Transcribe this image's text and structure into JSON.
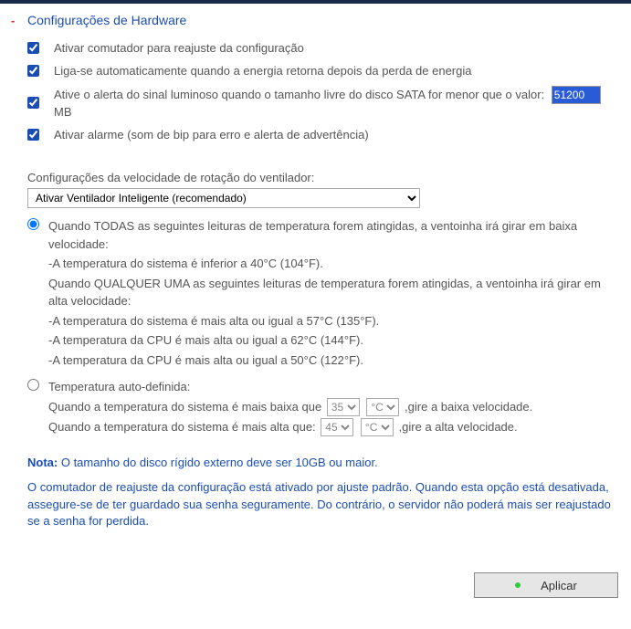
{
  "section": {
    "collapse_glyph": "-",
    "title": "Configurações de Hardware"
  },
  "checks": {
    "reset_switch": {
      "checked": true,
      "label": "Ativar comutador para reajuste da configuração"
    },
    "auto_power": {
      "checked": true,
      "label": "Liga-se automaticamente quando a energia retorna depois da perda de energia"
    },
    "sata_alert": {
      "checked": true,
      "label_before": "Ative o alerta do sinal luminoso quando o tamanho livre do disco SATA for menor que o valor:",
      "value": "51200",
      "label_after": "MB"
    },
    "buzzer": {
      "checked": true,
      "label": "Ativar alarme (som de bip para erro e alerta de advertência)"
    }
  },
  "fan": {
    "label": "Configurações da velocidade de rotação do ventilador:",
    "mode_selected": "Ativar Ventilador Inteligente (recomendado)",
    "smart": {
      "selected": true,
      "intro": "Quando TODAS as seguintes leituras de temperatura forem atingidas, a ventoinha irá girar em baixa velocidade:",
      "low1": "-A temperatura do sistema é inferior a 40°C (104°F).",
      "high_intro": "Quando QUALQUER UMA as seguintes leituras de temperatura forem atingidas, a ventoinha irá girar em alta velocidade:",
      "high1": "-A temperatura do sistema é mais alta ou igual a 57°C (135°F).",
      "high2": "-A temperatura da CPU é mais alta ou igual a 62°C (144°F).",
      "high3": "-A temperatura da CPU é mais alta ou igual a 50°C (122°F)."
    },
    "custom": {
      "selected": false,
      "title": "Temperatura auto-definida:",
      "low_before": "Quando a temperatura do sistema é mais baixa que",
      "low_temp": "35",
      "unit": "°C",
      "low_after": ",gire a baixa velocidade.",
      "high_before": "Quando a temperatura do sistema é mais alta que:",
      "high_temp": "45",
      "high_after": ",gire a alta velocidade."
    }
  },
  "note": {
    "label": "Nota:",
    "text1": "O tamanho do disco rígido externo deve ser 10GB ou maior.",
    "text2": "O comutador de reajuste da configuração está ativado por ajuste padrão. Quando esta opção está desativada, assegure-se de ter guardado sua senha seguramente. Do contrário, o servidor não poderá mais ser reajustado se a senha for perdida."
  },
  "footer": {
    "apply": "Aplicar"
  }
}
